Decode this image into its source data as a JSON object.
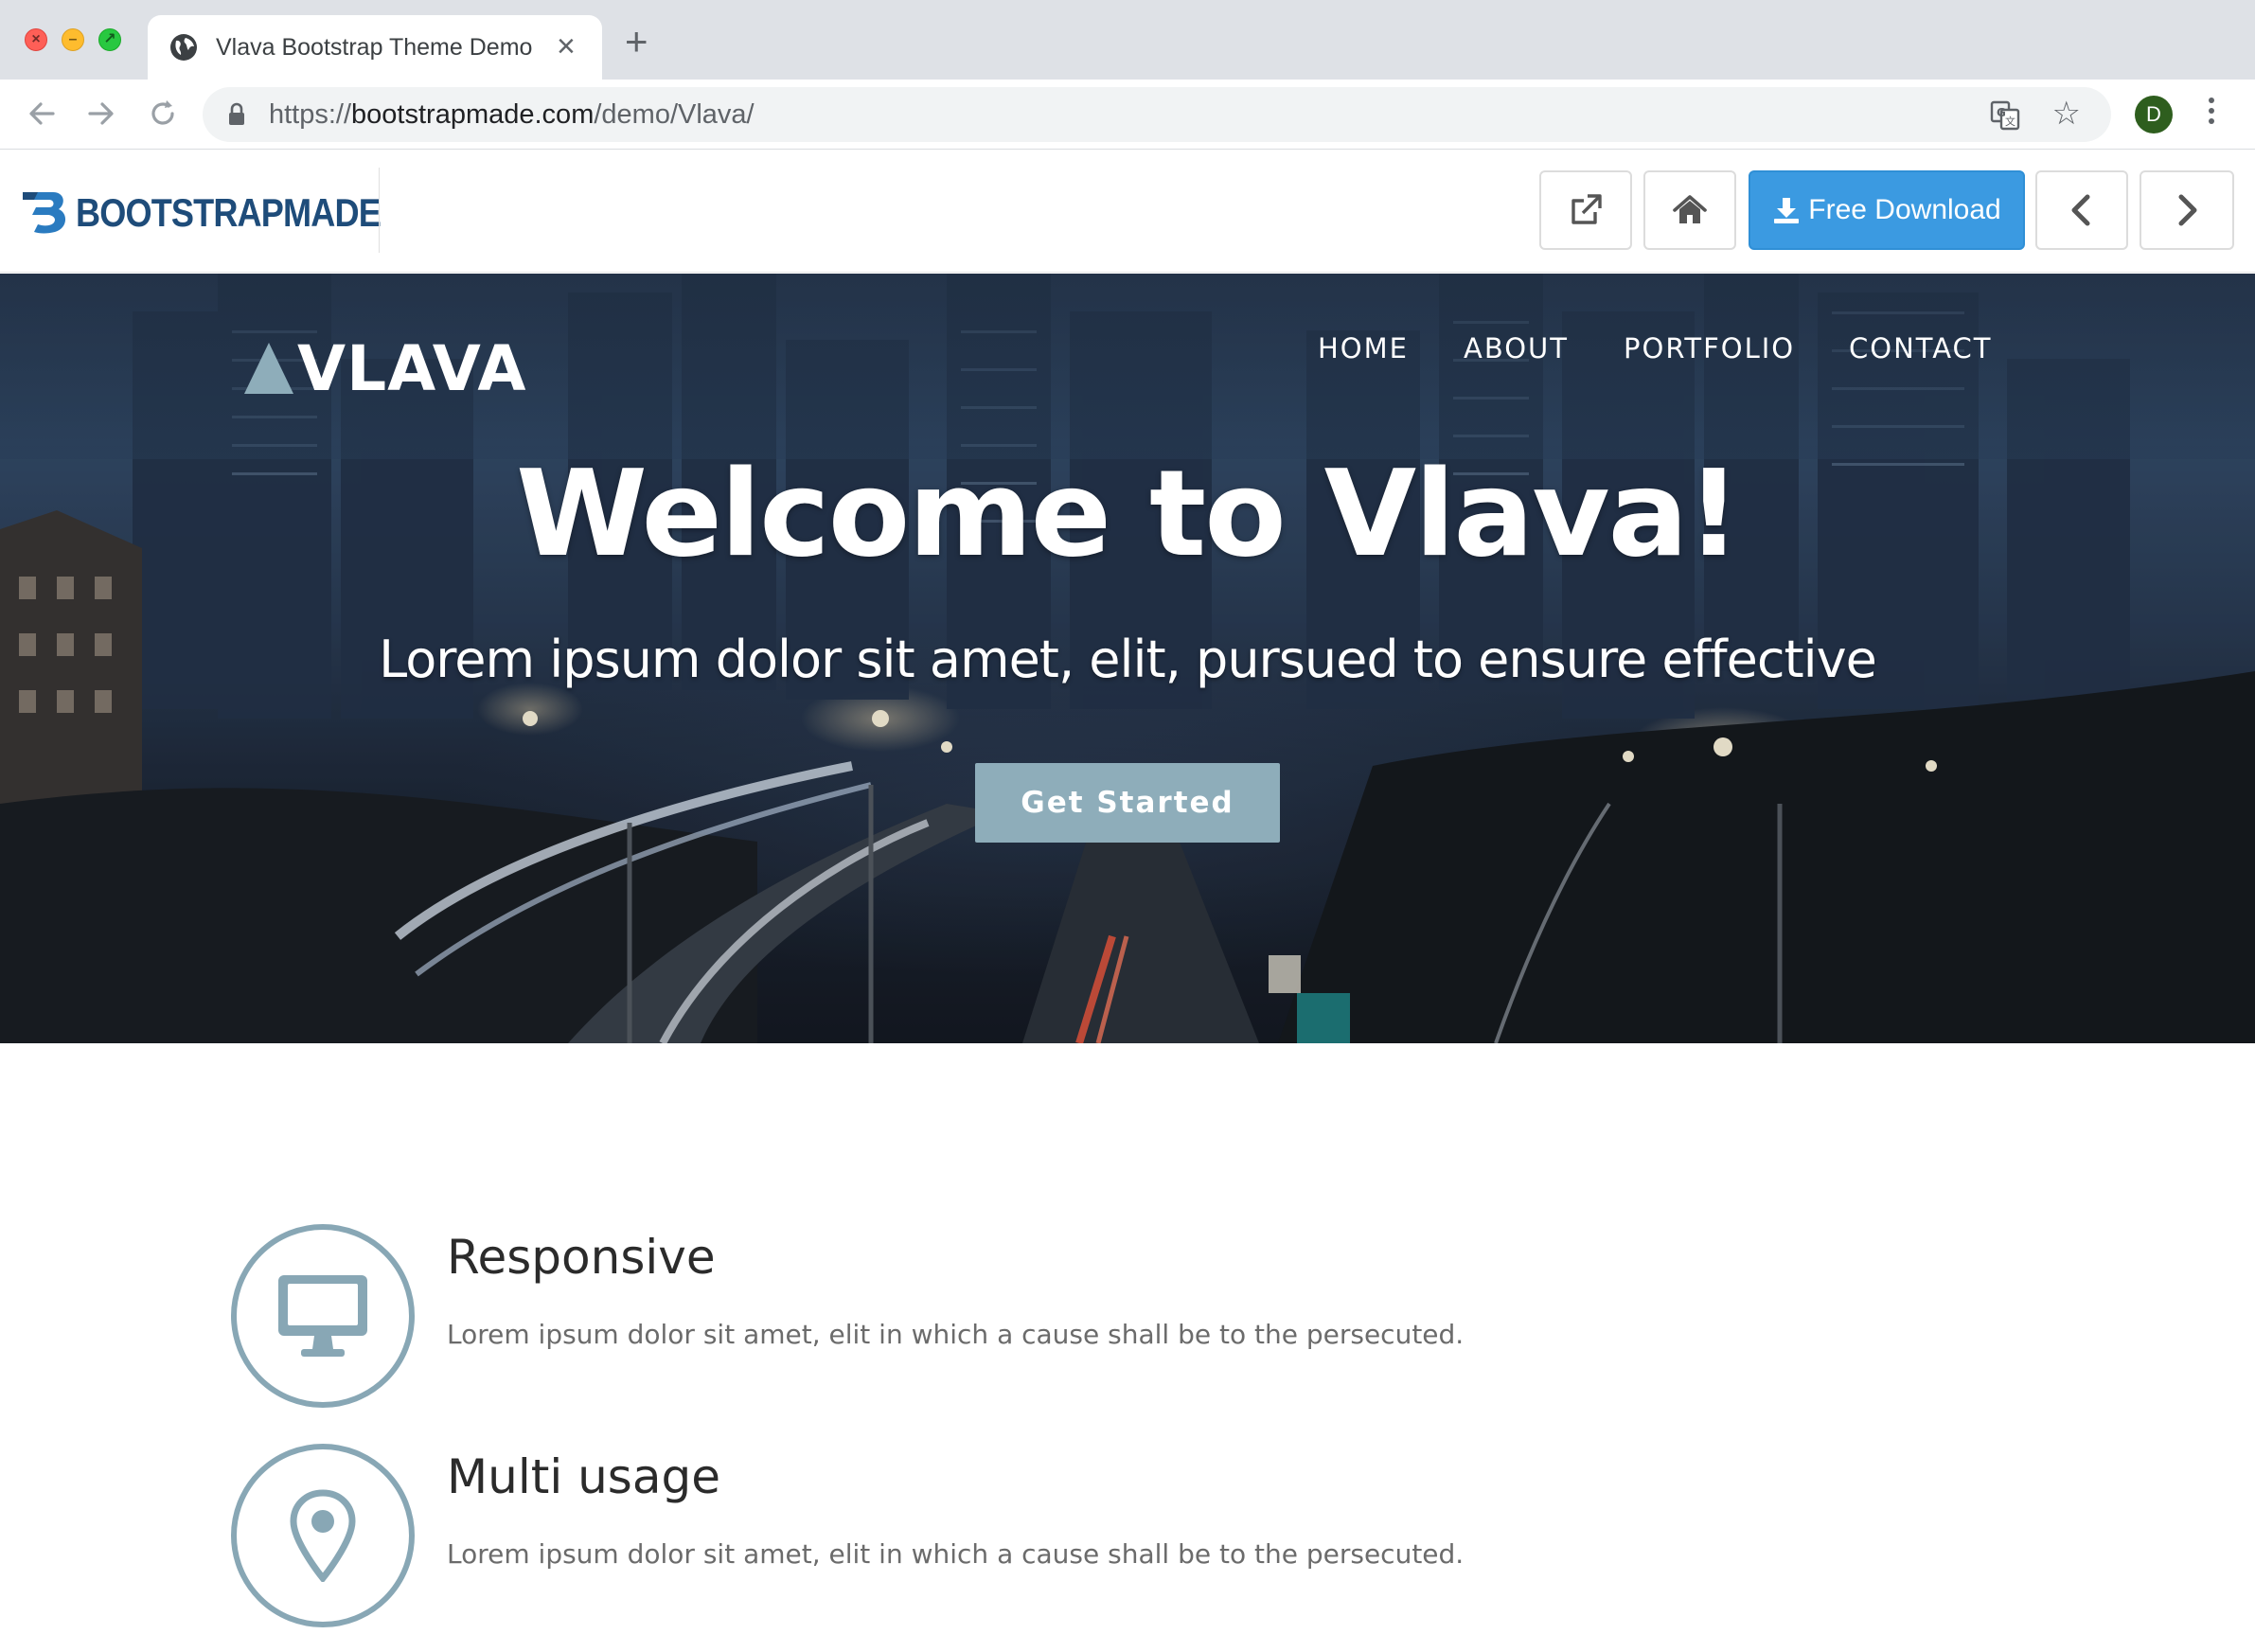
{
  "browser": {
    "tab_title": "Vlava Bootstrap Theme Demo",
    "url_scheme": "https://",
    "url_host": "bootstrapmade.com",
    "url_path": "/demo/Vlava/",
    "profile_initial": "D"
  },
  "bm_bar": {
    "logo_text": "BOOTSTRAPMADE",
    "download_label": "Free Download",
    "brand_color": "#1e4c7a",
    "download_color": "#3b9ae1"
  },
  "hero": {
    "logo_text": "VLAVA",
    "nav": [
      "HOME",
      "ABOUT",
      "PORTFOLIO",
      "CONTACT"
    ],
    "title": "Welcome to Vlava!",
    "subtitle": "Lorem ipsum dolor sit amet, elit, pursued to ensure effective",
    "cta_label": "Get Started",
    "accent_color": "#8eadba"
  },
  "features": [
    {
      "icon": "desktop-icon",
      "title": "Responsive",
      "text": "Lorem ipsum dolor sit amet, elit in which a cause shall be to the persecuted."
    },
    {
      "icon": "map-marker-icon",
      "title": "Multi usage",
      "text": "Lorem ipsum dolor sit amet, elit in which a cause shall be to the persecuted."
    }
  ]
}
